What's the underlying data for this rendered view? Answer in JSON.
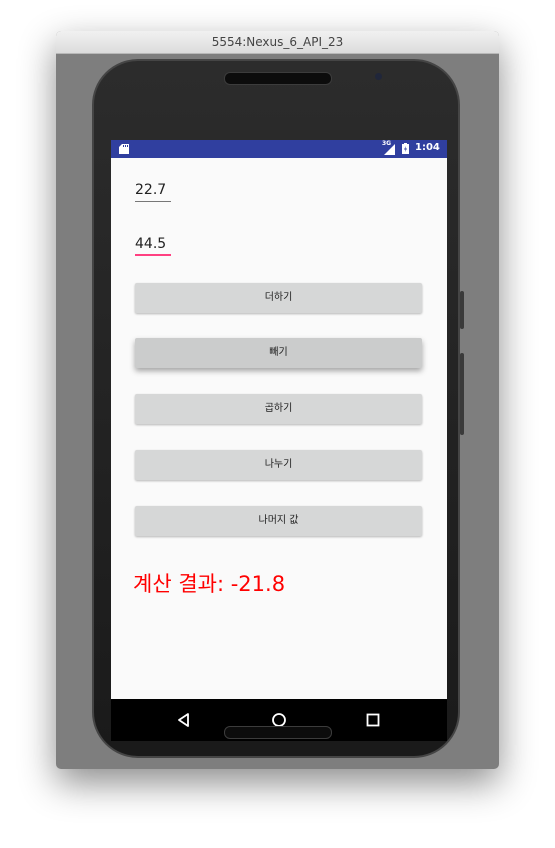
{
  "window": {
    "title": "5554:Nexus_6_API_23"
  },
  "status_bar": {
    "network": "3G",
    "time": "1:04",
    "bg_color": "#303f9f"
  },
  "form": {
    "first_value": "22.7",
    "second_value": "44.5",
    "focus_color": "#ff4081"
  },
  "buttons": {
    "add": "더하기",
    "subtract": "빼기",
    "multiply": "곱하기",
    "divide": "나누기",
    "remainder": "나머지 값"
  },
  "result": {
    "label": "계산 결과: ",
    "value": "-21.8",
    "color": "#ff0000"
  },
  "nav": {
    "back": "back-icon",
    "home": "home-icon",
    "recents": "recents-icon"
  }
}
